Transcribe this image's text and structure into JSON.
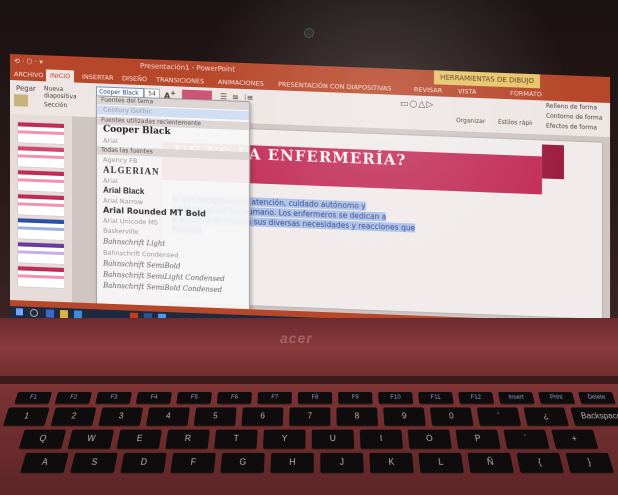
{
  "window": {
    "quick_access": "⟲ · ⬡ · ▾",
    "document_title": "Presentación1 - PowerPoint",
    "tools_label": "HERRAMIENTAS DE DIBUJO"
  },
  "ribbon_tabs": [
    {
      "label": "ARCHIVO",
      "active": false
    },
    {
      "label": "INICIO",
      "active": true
    },
    {
      "label": "INSERTAR",
      "active": false
    },
    {
      "label": "DISEÑO",
      "active": false
    },
    {
      "label": "TRANSICIONES",
      "active": false
    },
    {
      "label": "ANIMACIONES",
      "active": false
    },
    {
      "label": "PRESENTACIÓN CON DIAPOSITIVAS",
      "active": false
    },
    {
      "label": "REVISAR",
      "active": false
    },
    {
      "label": "VISTA",
      "active": false
    },
    {
      "label": "FORMATO",
      "active": false
    }
  ],
  "ribbon": {
    "paste_label": "Pegar",
    "font_name": "Cooper Black",
    "font_size": "54",
    "new_slide_label": "Nueva diapositiva",
    "section_label": "Sección",
    "arrange_label": "Organizar",
    "quick_styles_label": "Estilos rápidos",
    "shape_fill_label": "Relleno de forma",
    "shape_outline_label": "Contorno de forma",
    "shape_effects_label": "Efectos de forma"
  },
  "font_dropdown": {
    "theme_fonts_header": "Fuentes del tema",
    "theme_font_1": "Century Gothic",
    "recent_header": "Fuentes utilizadas recientemente",
    "recent_fonts": [
      "Cooper Black",
      "Arial"
    ],
    "all_header": "Todas las fuentes",
    "all_fonts": [
      "Agency FB",
      "ALGERIAN",
      "Arial",
      "Arial Black",
      "Arial Narrow",
      "Arial Rounded MT Bold",
      "Arial Unicode MS",
      "Baskerville",
      "Bahnschrift Light",
      "Bahnschrift Condensed",
      "Bahnschrift SemiBold",
      "Bahnschrift SemiLight Condensed",
      "Bahnschrift SemiBold Condensed"
    ]
  },
  "slide": {
    "title": "UÉ ES LA ENFERMERÍA?",
    "body_lines": [
      "ia que comprende la atención, cuidado autónomo y",
      "de la salud del ser humano. Los enfermeros se dedican a",
      "o a todo individuo en sus diversas necesidades y reacciones que",
      "interese"
    ]
  },
  "brand": "acer",
  "keyboard_rows": [
    [
      "F1",
      "F2",
      "F3",
      "F4",
      "F5",
      "F6",
      "F7",
      "F8",
      "F9",
      "F10",
      "F11",
      "F12",
      "Insert",
      "Print",
      "Delete"
    ],
    [
      "1",
      "2",
      "3",
      "4",
      "5",
      "6",
      "7",
      "8",
      "9",
      "0",
      "'",
      "¿",
      "Backspace"
    ],
    [
      "Q",
      "W",
      "E",
      "R",
      "T",
      "Y",
      "U",
      "I",
      "O",
      "P",
      "´",
      "+"
    ],
    [
      "A",
      "S",
      "D",
      "F",
      "G",
      "H",
      "J",
      "K",
      "L",
      "Ñ",
      "{",
      "}"
    ]
  ],
  "colors": {
    "accent_ppt": "#b7472a",
    "slide_banner": "#c32f59",
    "laptop_red": "#7d3435"
  }
}
